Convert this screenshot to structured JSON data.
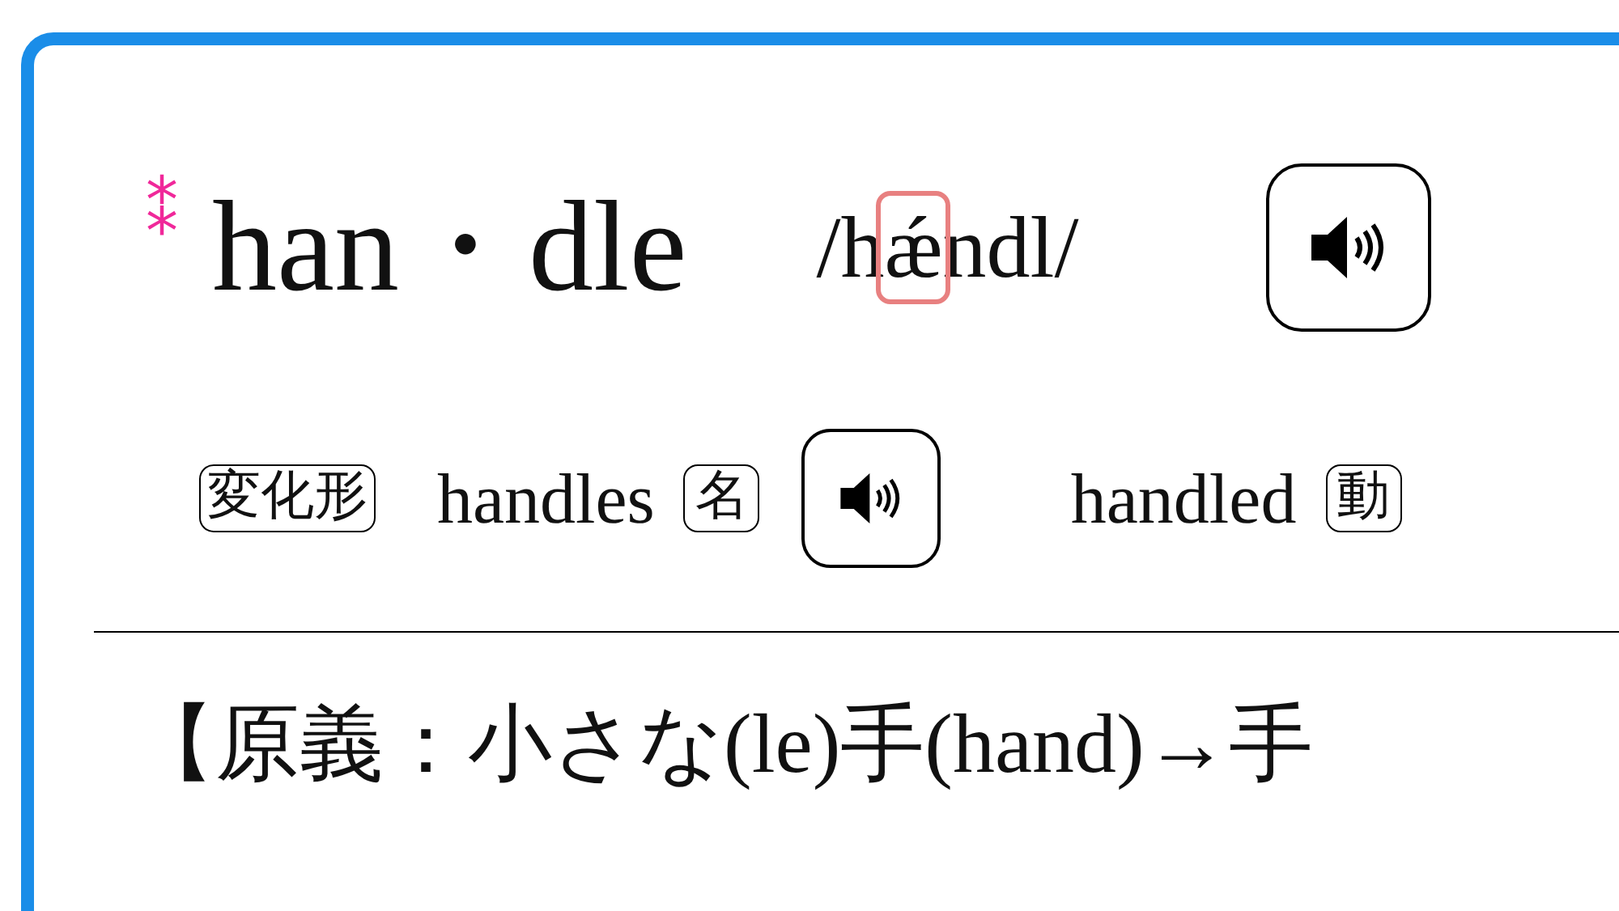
{
  "headword": {
    "text": "han・dle",
    "importance_mark": "⁑"
  },
  "pronunciation": {
    "parts": [
      {
        "text": "/h",
        "highlighted": false
      },
      {
        "text": "ǽ",
        "highlighted": true
      },
      {
        "text": "ndl/",
        "highlighted": false
      }
    ]
  },
  "inflections": {
    "label": "変化形",
    "items": [
      {
        "word": "handles",
        "pos": "名",
        "audio": true
      },
      {
        "word": "handled",
        "pos": "動",
        "audio": false
      }
    ]
  },
  "etymology": "【原義：小さな(le)手(hand)→手"
}
